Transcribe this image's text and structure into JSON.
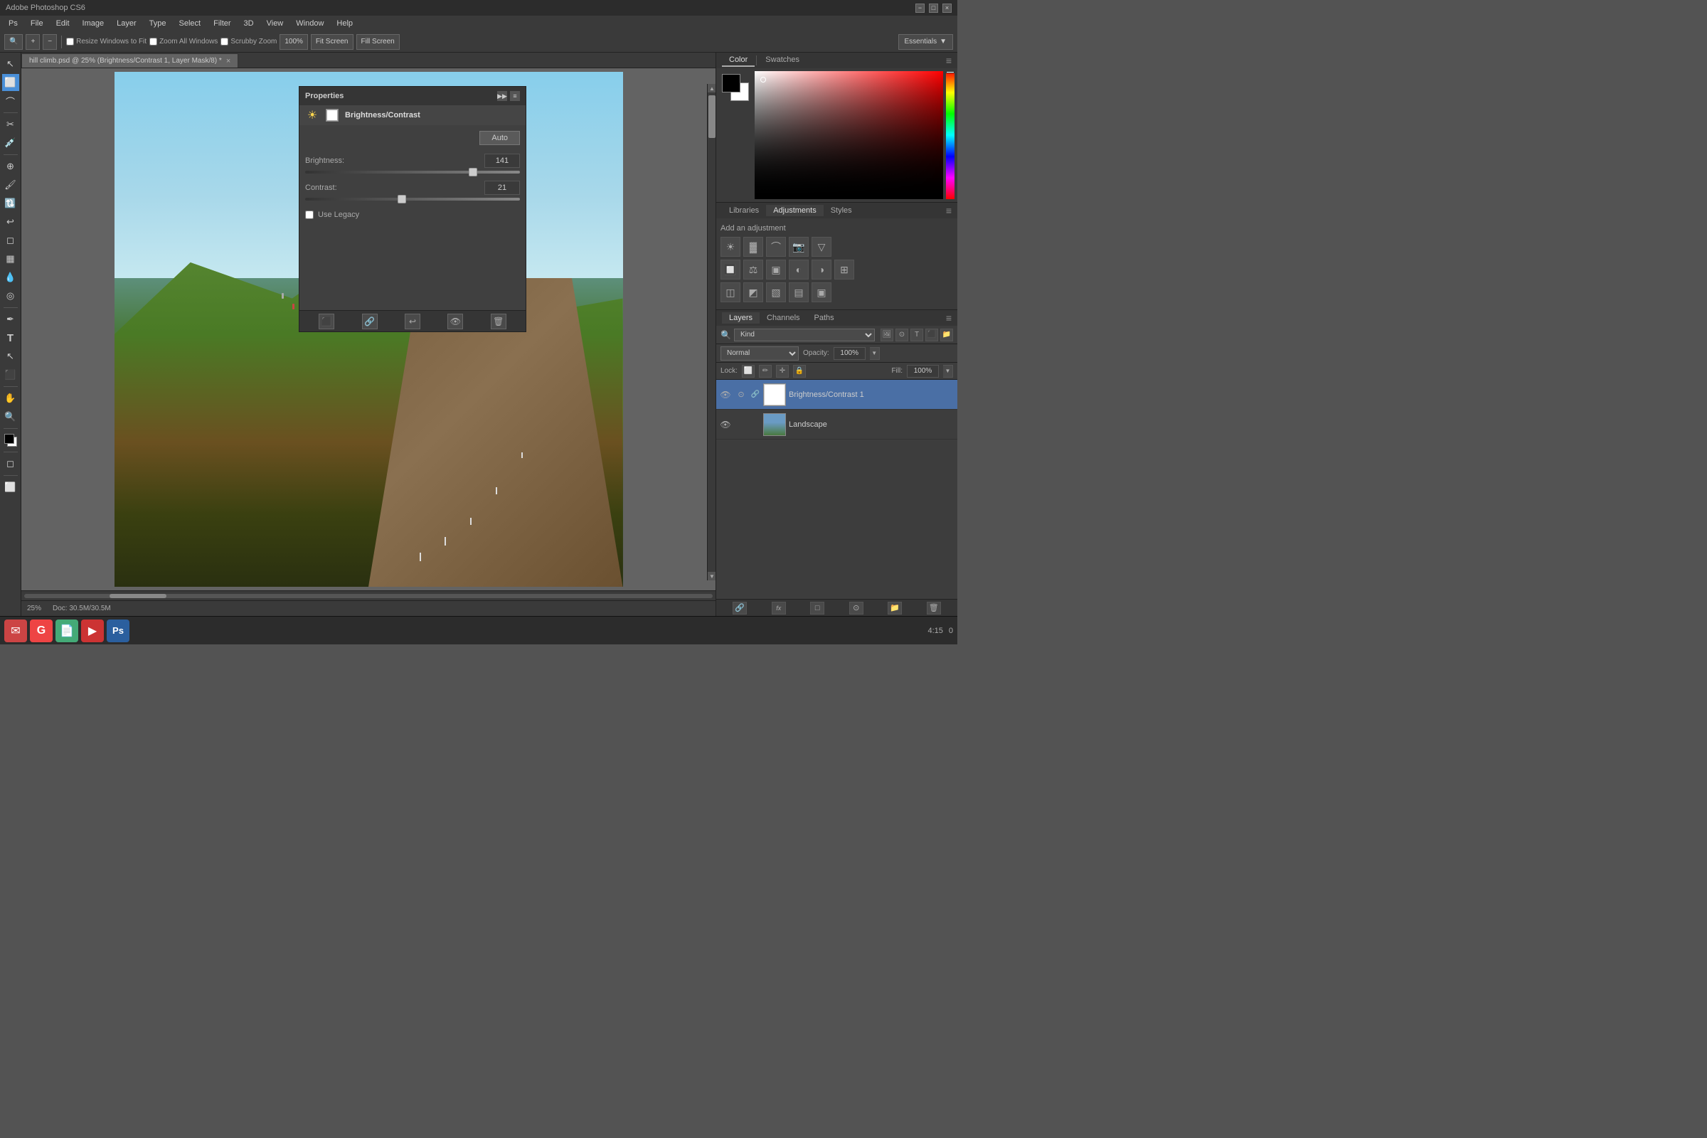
{
  "titlebar": {
    "title": "Adobe Photoshop CS6",
    "minimize": "−",
    "maximize": "□",
    "close": "×"
  },
  "menubar": {
    "items": [
      "PS",
      "File",
      "Edit",
      "Image",
      "Layer",
      "Type",
      "Select",
      "Filter",
      "3D",
      "View",
      "Window",
      "Help"
    ]
  },
  "toolbar": {
    "zoom_icon": "🔍",
    "zoom_in": "+",
    "zoom_out": "−",
    "resize_windows_label": "Resize Windows to Fit",
    "zoom_all_windows_label": "Zoom All Windows",
    "scrubby_zoom_label": "Scrubby Zoom",
    "zoom_value": "100%",
    "fit_screen_label": "Fit Screen",
    "fill_screen_label": "Fill Screen",
    "essentials_label": "Essentials",
    "essentials_arrow": "▼"
  },
  "doc_tab": {
    "label": "hill climb.psd @ 25% (Brightness/Contrast 1, Layer Mask/8) *",
    "close": "×"
  },
  "properties": {
    "title": "Properties",
    "expand": "▶▶",
    "menu": "≡",
    "layer_icon": "☀",
    "mask_icon": "",
    "layer_name": "Brightness/Contrast",
    "auto_label": "Auto",
    "brightness_label": "Brightness:",
    "brightness_value": "141",
    "contrast_label": "Contrast:",
    "contrast_value": "21",
    "use_legacy_label": "Use Legacy",
    "brightness_slider_pct": 78,
    "contrast_slider_pct": 45,
    "footer_icons": [
      "⬛",
      "🔗",
      "↩",
      "👁",
      "🗑"
    ]
  },
  "color_panel": {
    "tab_color": "Color",
    "tab_swatches": "Swatches",
    "active_tab": "Color"
  },
  "adjustments_panel": {
    "tab_libraries": "Libraries",
    "tab_adjustments": "Adjustments",
    "tab_styles": "Styles",
    "active_tab": "Adjustments",
    "title": "Add an adjustment",
    "icons_row1": [
      "☀",
      "🌙",
      "⊕",
      "📷",
      "▽"
    ],
    "icons_row2": [
      "🔲",
      "⚖",
      "▣",
      "🔵",
      "🔴",
      "⊞"
    ],
    "icons_row3": [
      "◫",
      "◩",
      "▧",
      "✕",
      "▣"
    ]
  },
  "layers_panel": {
    "tab_layers": "Layers",
    "tab_channels": "Channels",
    "tab_paths": "Paths",
    "active_tab": "Layers",
    "filter_label": "Kind",
    "blend_mode": "Normal",
    "opacity_label": "Opacity:",
    "opacity_value": "100%",
    "lock_label": "Lock:",
    "fill_label": "Fill:",
    "fill_value": "100%",
    "layers": [
      {
        "name": "Brightness/Contrast 1",
        "type": "adjustment",
        "visible": true,
        "active": true,
        "eye": "👁",
        "icon": "⊙"
      },
      {
        "name": "Landscape",
        "type": "image",
        "visible": true,
        "active": false,
        "eye": "👁",
        "icon": ""
      }
    ],
    "footer_icons": [
      "🔗",
      "fx",
      "□",
      "⊙",
      "📁",
      "🗑"
    ]
  },
  "status_bar": {
    "zoom": "25%",
    "doc_info": "Doc: 30.5M/30.5M"
  },
  "taskbar": {
    "apps": [
      {
        "icon": "✉",
        "color": "#d44",
        "name": "gmail"
      },
      {
        "icon": "G",
        "color": "#e44",
        "name": "google"
      },
      {
        "icon": "📄",
        "color": "#4a7",
        "name": "docs"
      },
      {
        "icon": "▶",
        "color": "#c33",
        "name": "youtube"
      },
      {
        "icon": "Ps",
        "color": "#2b5f9e",
        "name": "photoshop"
      }
    ],
    "right_time": "4:",
    "right_value": "0"
  }
}
